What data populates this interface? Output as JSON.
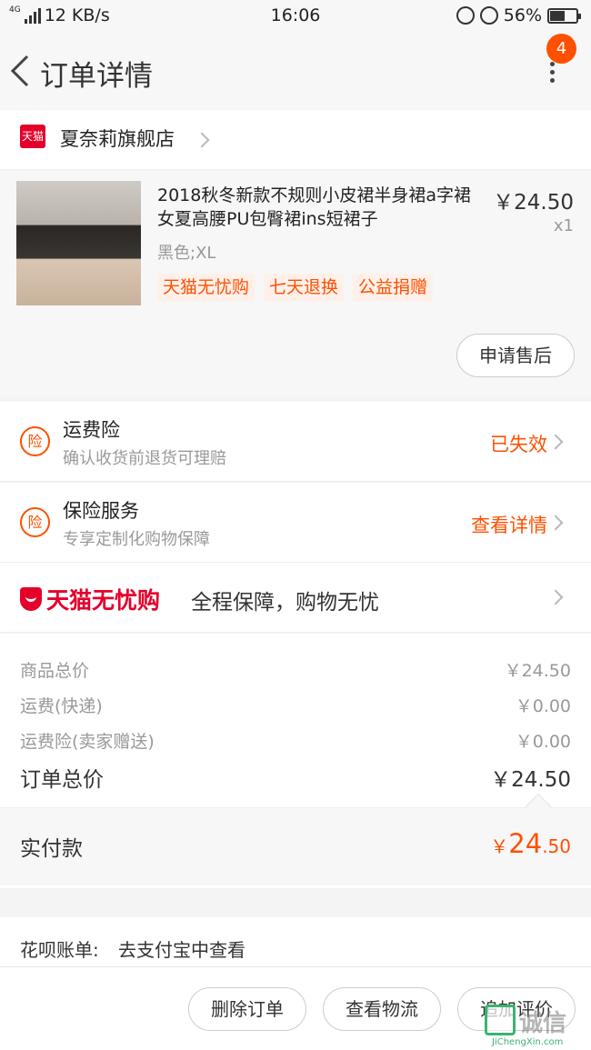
{
  "status_bar": {
    "network_type": "4G",
    "speed": "12 KB/s",
    "time": "16:06",
    "battery": "56%"
  },
  "nav": {
    "title": "订单详情",
    "badge_count": "4"
  },
  "store": {
    "logo_text": "天猫",
    "name": "夏奈莉旗舰店"
  },
  "product": {
    "title": "2018秋冬新款不规则小皮裙半身裙a字裙女夏高腰PU包臀裙ins短裙子",
    "price": "￥24.50",
    "quantity": "x1",
    "sku": "黑色;XL",
    "tags": [
      "天猫无忧购",
      "七天退换",
      "公益捐赠"
    ],
    "after_sale_button": "申请售后"
  },
  "insurance": [
    {
      "icon_text": "险",
      "title": "运费险",
      "subtitle": "确认收货前退货可理赔",
      "status": "已失效"
    },
    {
      "icon_text": "险",
      "title": "保险服务",
      "subtitle": "专享定制化购物保障",
      "status": "查看详情"
    }
  ],
  "worry_free": {
    "brand": "天猫无忧购",
    "text": "全程保障，购物无忧"
  },
  "summary": {
    "rows": [
      {
        "label": "商品总价",
        "value": "￥24.50"
      },
      {
        "label": "运费(快递)",
        "value": "￥0.00"
      },
      {
        "label": "运费险(卖家赠送)",
        "value": "￥0.00"
      }
    ],
    "total_label": "订单总价",
    "total_value": "￥24.50",
    "paid_label": "实付款",
    "paid_currency": "￥",
    "paid_integer": "24",
    "paid_decimal": ".50"
  },
  "huabei": {
    "label": "花呗账单:",
    "value": "去支付宝中查看"
  },
  "bottom_buttons": {
    "delete": "删除订单",
    "logistics": "查看物流",
    "review": "追加评价"
  },
  "watermark": {
    "text": "诚信",
    "site": "JiChengXin.com"
  },
  "colors": {
    "accent": "#ff5000",
    "tmall_red": "#e4002b"
  }
}
